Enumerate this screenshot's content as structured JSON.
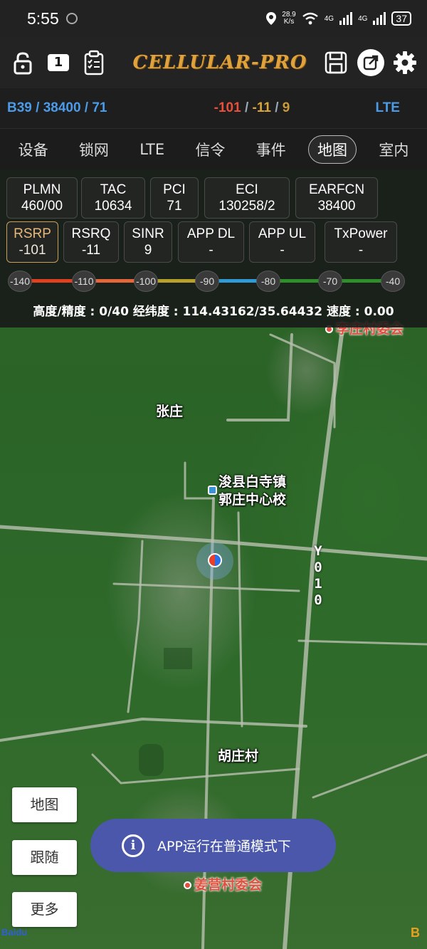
{
  "status_bar": {
    "time": "5:55",
    "speed_value": "28.9",
    "speed_unit": "K/s",
    "net1": "4G",
    "net2": "4G",
    "battery": "37"
  },
  "toolbar": {
    "badge_number": "1",
    "logo_text": "CELLULAR-PRO"
  },
  "info_bar": {
    "band": "B39 / 38400 / 71",
    "signal_a": "-101",
    "signal_sep1": " / ",
    "signal_b": "-11",
    "signal_sep2": " / ",
    "signal_c": "9",
    "tech": "LTE"
  },
  "tabs": [
    "设备",
    "锁网",
    "LTE",
    "信令",
    "事件",
    "地图",
    "室内"
  ],
  "active_tab": "地图",
  "params_row1": [
    {
      "label": "PLMN",
      "value": "460/00"
    },
    {
      "label": "TAC",
      "value": "10634"
    },
    {
      "label": "PCI",
      "value": "71"
    },
    {
      "label": "ECI",
      "value": "130258/2"
    },
    {
      "label": "EARFCN",
      "value": "38400"
    }
  ],
  "params_row2": [
    {
      "label": "RSRP",
      "value": "-101"
    },
    {
      "label": "RSRQ",
      "value": "-11"
    },
    {
      "label": "SINR",
      "value": "9"
    },
    {
      "label": "APP DL",
      "value": "-"
    },
    {
      "label": "APP UL",
      "value": "-"
    },
    {
      "label": "TxPower",
      "value": "-"
    }
  ],
  "scale_ticks": [
    "-140",
    "-110",
    "-100",
    "-90",
    "-80",
    "-70",
    "-40"
  ],
  "scale_colors": [
    "#e0401e",
    "#e4663a",
    "#b8a02c",
    "#2f9ad6",
    "#2e8f2a",
    "#2e8f2a"
  ],
  "coords_text": "高度/精度 : 0/40  经纬度 : 114.43162/35.64432  速度 : 0.00",
  "map": {
    "labels": {
      "lizhuang": "李庄村委会",
      "zhangzhuang": "张庄",
      "school_line1": "浚县白寺镇",
      "school_line2": "郭庄中心校",
      "huzhuang": "胡庄村",
      "jiangying": "姜营村委会",
      "road": "Y010"
    }
  },
  "buttons": {
    "map": "地图",
    "follow": "跟随",
    "more": "更多"
  },
  "toast": {
    "icon": "i",
    "text": "APP运行在普通模式下"
  },
  "footer": {
    "baidu": "Baidu",
    "corner": "B"
  }
}
